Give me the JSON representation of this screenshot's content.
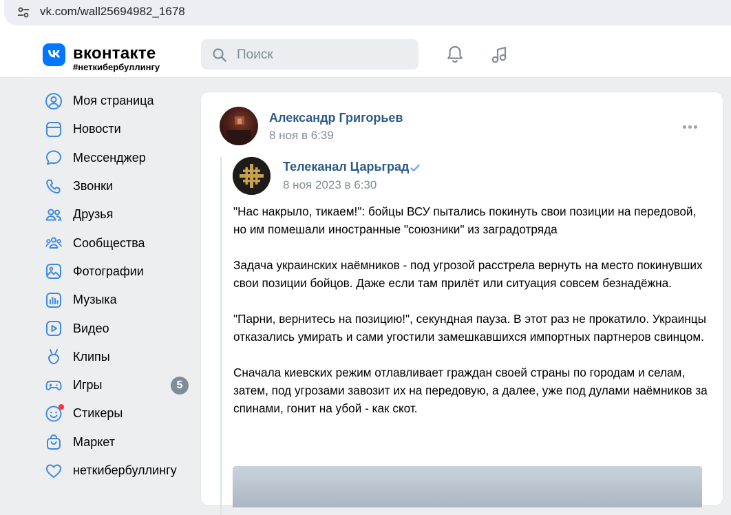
{
  "browser": {
    "url": "vk.com/wall25694982_1678"
  },
  "header": {
    "logo_text": "вконтакте",
    "tagline": "#неткибербуллингу",
    "search_placeholder": "Поиск"
  },
  "sidebar": {
    "items": [
      {
        "label": "Моя страница",
        "icon": "user-circle-icon"
      },
      {
        "label": "Новости",
        "icon": "news-icon"
      },
      {
        "label": "Мессенджер",
        "icon": "message-icon"
      },
      {
        "label": "Звонки",
        "icon": "phone-icon"
      },
      {
        "label": "Друзья",
        "icon": "friends-icon"
      },
      {
        "label": "Сообщества",
        "icon": "communities-icon"
      },
      {
        "label": "Фотографии",
        "icon": "photo-icon"
      },
      {
        "label": "Музыка",
        "icon": "music-bars-icon"
      },
      {
        "label": "Видео",
        "icon": "video-icon"
      },
      {
        "label": "Клипы",
        "icon": "clips-icon"
      },
      {
        "label": "Игры",
        "icon": "gamepad-icon",
        "badge": "5"
      },
      {
        "label": "Стикеры",
        "icon": "sticker-icon"
      },
      {
        "label": "Маркет",
        "icon": "bag-icon"
      },
      {
        "label": "неткибербуллингу",
        "icon": "heart-icon"
      }
    ]
  },
  "post": {
    "author": "Александр Григорьев",
    "time": "8 ноя в 6:39",
    "repost": {
      "author": "Телеканал Царьград",
      "time": "8 ноя 2023 в 6:30",
      "paragraphs": [
        "\"Нас накрыло, тикаем!\": бойцы ВСУ пытались покинуть свои позиции на передовой, но им помешали иностранные \"союзники\" из заградотряда",
        "Задача украинских наёмников - под угрозой расстрела вернуть на место покинувших свои позиции бойцов. Даже если там прилёт или ситуация совсем безнадёжна.",
        "\"Парни, вернитесь на позицию!\", секундная пауза. В этот раз не прокатило. Украинцы отказались умирать и сами угостили замешкавшихся импортных партнеров свинцом.",
        "Сначала киевских режим отлавливает граждан своей страны по городам и селам, затем, под угрозами завозит их на передовую, а далее, уже под дулами наёмников за спинами, гонит на убой - как скот."
      ]
    }
  },
  "colors": {
    "brand": "#0077ff",
    "link": "#2c5a88",
    "muted": "#818c99",
    "icon": "#3f8ae0"
  }
}
